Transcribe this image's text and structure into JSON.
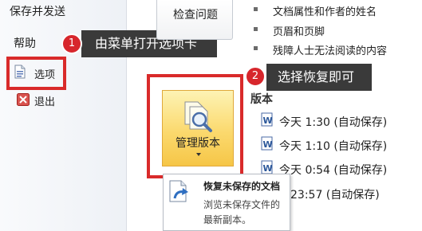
{
  "nav": {
    "save_send": "保存并发送",
    "help": "帮助",
    "options": "选项",
    "exit": "退出"
  },
  "callouts": {
    "step1_number": "1",
    "step1_text": "由菜单打开选项卡",
    "step2_number": "2",
    "step2_text": "选择恢复即可"
  },
  "check_issues": {
    "label": "检查问题"
  },
  "inspect_list": [
    "文档属性和作者的姓名",
    "页眉和页脚",
    "残障人士无法阅读的内容"
  ],
  "manage_version": {
    "label": "管理版本"
  },
  "versions": {
    "heading": "版本",
    "items": [
      "今天 1:30 (自动保存)",
      "今天 1:10 (自动保存)",
      "今天 0:54 (自动保存)",
      "23:57 (自动保存)"
    ]
  },
  "dropdown": {
    "title": "恢复未保存的文档",
    "desc_line1": "浏览未保存文件的",
    "desc_line2": "最新副本。"
  },
  "colors": {
    "accent_red": "#d92a2a",
    "callout_bg": "#3a3a3a",
    "button_gold": "#f6c647"
  }
}
